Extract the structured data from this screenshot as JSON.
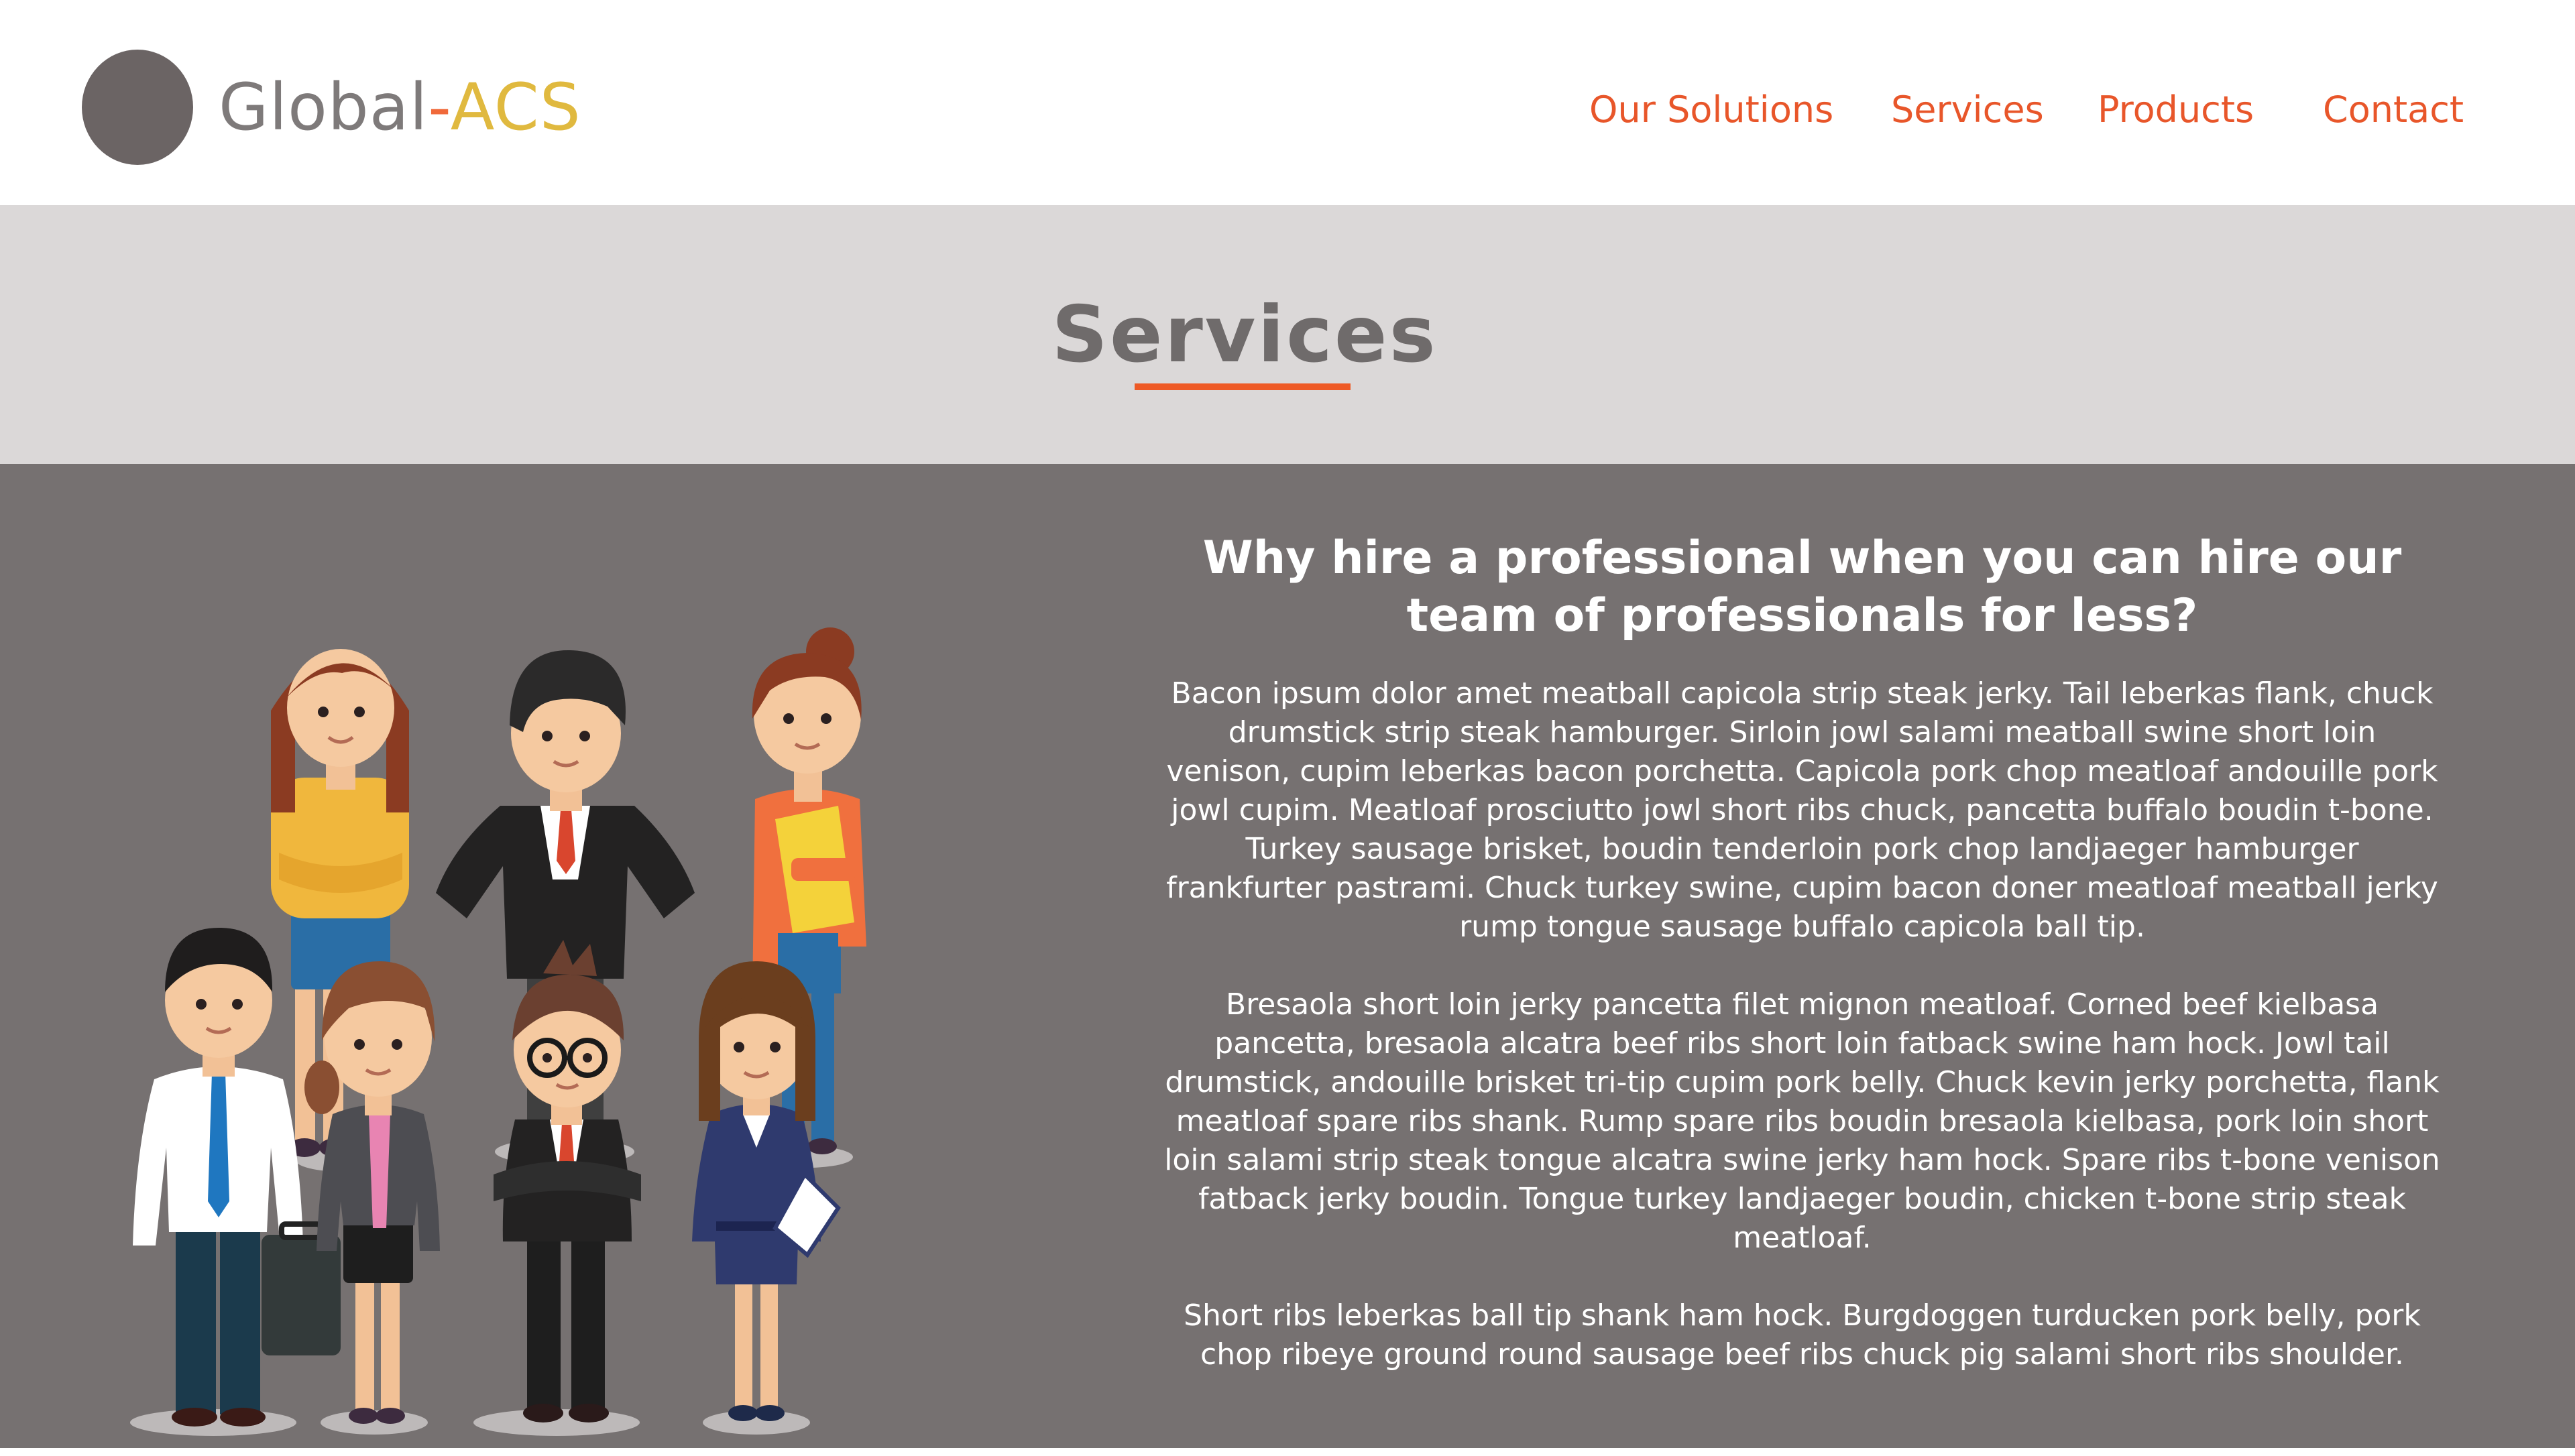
{
  "header": {
    "logo": {
      "name_part1": "Global",
      "dash": "-",
      "name_part2": "ACS"
    },
    "nav": [
      {
        "label": "Our Solutions"
      },
      {
        "label": "Services"
      },
      {
        "label": "Products"
      },
      {
        "label": "Contact"
      }
    ]
  },
  "title_band": {
    "title": "Services"
  },
  "content": {
    "headline": "Why hire a professional when you can hire our team of professionals for less?",
    "paragraphs": [
      "Bacon ipsum dolor amet meatball capicola strip steak jerky. Tail leberkas flank, chuck drumstick strip steak hamburger. Sirloin jowl salami meatball swine short loin venison, cupim leberkas bacon porchetta. Capicola pork chop meatloaf andouille pork jowl cupim. Meatloaf prosciutto jowl short ribs chuck, pancetta buffalo boudin t-bone. Turkey sausage brisket, boudin tenderloin pork chop landjaeger hamburger frankfurter pastrami. Chuck turkey swine, cupim bacon doner meatloaf meatball jerky rump tongue sausage buffalo capicola ball tip.",
      "Bresaola short loin jerky pancetta filet mignon meatloaf. Corned beef kielbasa pancetta, bresaola alcatra beef ribs short loin fatback swine ham hock. Jowl tail drumstick, andouille brisket tri-tip cupim pork belly. Chuck kevin jerky porchetta, flank meatloaf spare ribs shank. Rump spare ribs boudin bresaola kielbasa, pork loin short loin salami strip steak tongue alcatra swine jerky ham hock. Spare ribs t-bone venison fatback jerky boudin. Tongue turkey landjaeger boudin, chicken t-bone strip steak meatloaf.",
      "Short ribs leberkas ball tip shank ham hock. Burgdoggen turducken pork belly, pork chop ribeye ground round sausage beef ribs chuck pig salami short ribs shoulder."
    ]
  },
  "colors": {
    "accent_orange": "#e8562a",
    "logo_gold": "#e0b93f",
    "title_band_bg": "#dbd8d8",
    "content_bg": "#767171"
  }
}
